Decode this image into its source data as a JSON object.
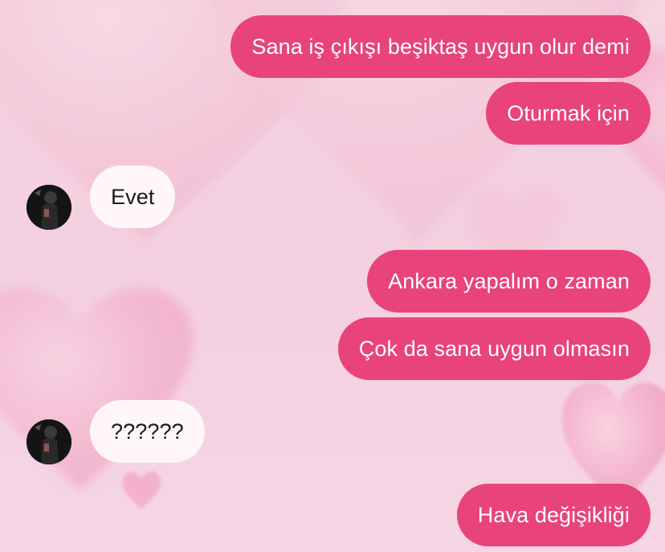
{
  "theme": {
    "background": "#f4d2e1",
    "outgoing_bubble": "#e8437a",
    "incoming_bubble": "#fff6f7",
    "heart_color": "#f08cb0"
  },
  "messages": [
    {
      "direction": "outgoing",
      "text": "Sana iş çıkışı beşiktaş uygun olur demi"
    },
    {
      "direction": "outgoing",
      "text": "Oturmak için"
    },
    {
      "direction": "incoming",
      "text": "Evet",
      "avatar": "profile-photo"
    },
    {
      "direction": "outgoing",
      "text": "Ankara yapalım o zaman"
    },
    {
      "direction": "outgoing",
      "text": "Çok da sana uygun olmasın"
    },
    {
      "direction": "incoming",
      "text": "??????",
      "avatar": "profile-photo"
    },
    {
      "direction": "outgoing",
      "text": "Hava değişikliği"
    }
  ]
}
